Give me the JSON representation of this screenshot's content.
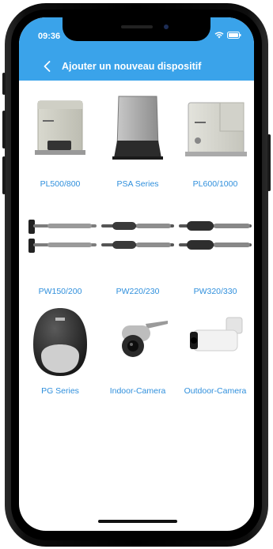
{
  "status_bar": {
    "time": "09:36"
  },
  "header": {
    "title": "Ajouter un nouveau dispositif",
    "back_icon": "chevron-left-icon",
    "color": "#3aa3ea"
  },
  "products": [
    {
      "label": "PL500/800",
      "icon": "sliding-gate-motor-pl500-icon"
    },
    {
      "label": "PSA Series",
      "icon": "sliding-gate-motor-psa-icon"
    },
    {
      "label": "PL600/1000",
      "icon": "sliding-gate-motor-pl600-icon"
    },
    {
      "label": "PW150/200",
      "icon": "swing-gate-arm-pw150-icon"
    },
    {
      "label": "PW220/230",
      "icon": "swing-gate-arm-pw220-icon"
    },
    {
      "label": "PW320/330",
      "icon": "swing-gate-arm-pw320-icon"
    },
    {
      "label": "PG Series",
      "icon": "garage-opener-pg-icon"
    },
    {
      "label": "Indoor-Camera",
      "icon": "indoor-camera-icon"
    },
    {
      "label": "Outdoor-Camera",
      "icon": "outdoor-camera-icon"
    }
  ],
  "label_color": "#2f8fdc"
}
